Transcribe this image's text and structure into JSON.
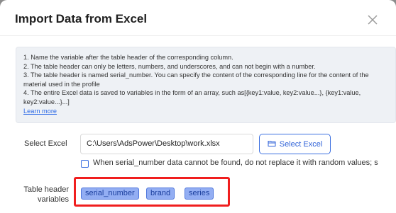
{
  "dialog": {
    "title": "Import Data from Excel"
  },
  "info": {
    "lines": [
      "1. Name the variable after the table header of the corresponding column.",
      "2. The table header can only be letters, numbers, and underscores, and can not begin with a number.",
      "3. The table header is named serial_number. You can specify the content of the corresponding line for the content of the material used in the profile",
      "4. The entire Excel data is saved to variables in the form of an array, such as[{key1:value, key2:value...}, {key1:value, key2:value...}...]"
    ],
    "learn_more": "Learn more"
  },
  "select_excel": {
    "label": "Select Excel",
    "path_value": "C:\\Users\\AdsPower\\Desktop\\work.xlsx",
    "button_label": "Select Excel",
    "button_icon": "folder-icon"
  },
  "option": {
    "checked": false,
    "label": "When serial_number data cannot be found, do not replace it with random values; s"
  },
  "table_header": {
    "label": "Table header variables",
    "variables": [
      "serial_number",
      "brand",
      "series"
    ]
  },
  "colors": {
    "accent": "#2f62d8",
    "highlight_frame": "#f01e1e",
    "tag_bg": "#93aef3"
  }
}
